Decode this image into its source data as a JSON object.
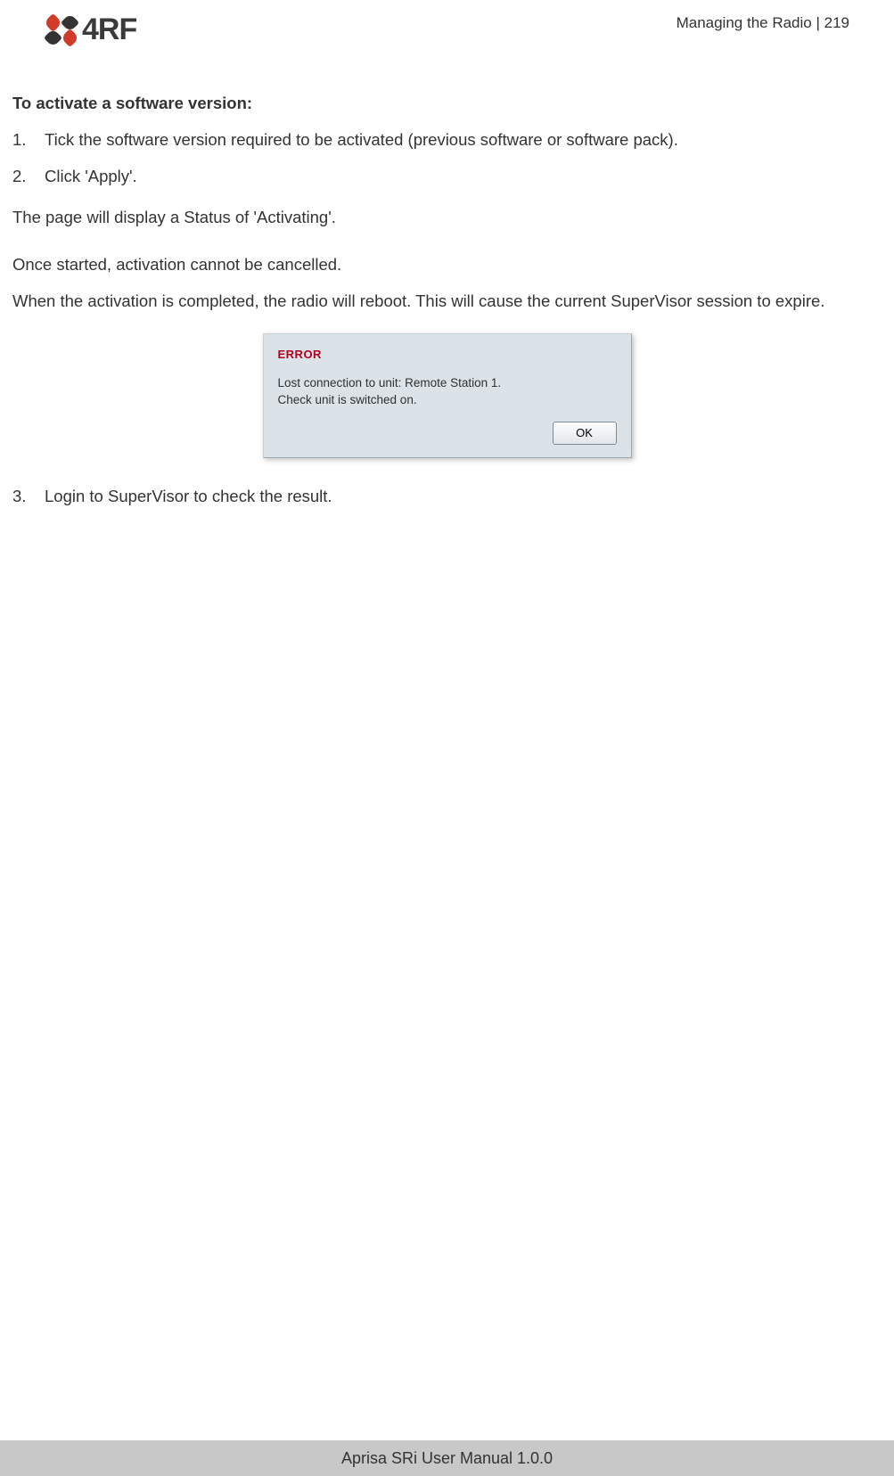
{
  "header": {
    "logo_text": "4RF",
    "section": "Managing the Radio",
    "separator": "  |  ",
    "page": "219"
  },
  "body": {
    "heading": "To activate a software version:",
    "steps_top": [
      {
        "num": "1.",
        "text": "Tick the software version required to be activated (previous software or software pack)."
      },
      {
        "num": "2.",
        "text": "Click 'Apply'."
      }
    ],
    "para1": "The page will display a Status of 'Activating'.",
    "para2": "Once started, activation cannot be cancelled.",
    "para3": "When the activation is completed, the radio will reboot. This will cause the current SuperVisor session to expire.",
    "steps_bottom": [
      {
        "num": "3.",
        "text": "Login to SuperVisor to check the result."
      }
    ]
  },
  "dialog": {
    "error_label": "ERROR",
    "line1": "Lost connection to unit: Remote Station 1.",
    "line2": "Check unit is switched on.",
    "ok": "OK"
  },
  "footer": {
    "text": "Aprisa SRi User Manual 1.0.0"
  }
}
